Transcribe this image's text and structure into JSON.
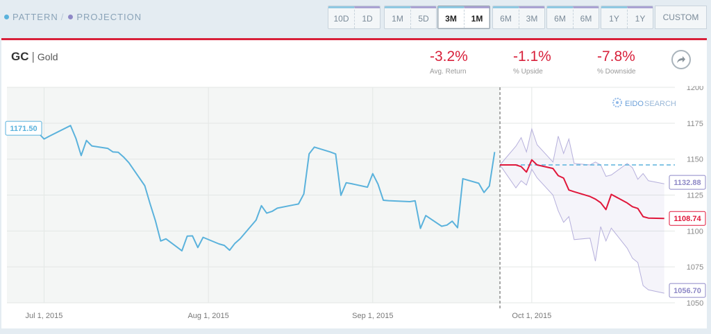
{
  "nav": {
    "pattern": "PATTERN",
    "separator": "/",
    "projection": "PROJECTION",
    "pattern_color": "#5ab2dc",
    "projection_color": "#8e88c6"
  },
  "ranges": [
    {
      "left": "10D",
      "right": "1D",
      "active": false
    },
    {
      "left": "1M",
      "right": "5D",
      "active": false
    },
    {
      "left": "3M",
      "right": "1M",
      "active": true
    },
    {
      "left": "6M",
      "right": "3M",
      "active": false
    },
    {
      "left": "6M",
      "right": "6M",
      "active": false
    },
    {
      "left": "1Y",
      "right": "1Y",
      "active": false
    }
  ],
  "custom_label": "CUSTOM",
  "header": {
    "symbol": "GC",
    "divider": "|",
    "name": "Gold"
  },
  "stats": [
    {
      "value": "-3.2%",
      "label": "Avg. Return"
    },
    {
      "value": "-1.1%",
      "label": "% Upside"
    },
    {
      "value": "-7.8%",
      "label": "% Downside"
    }
  ],
  "share_icon": "share-arrow-icon",
  "watermark": {
    "eido": "EIDO",
    "search": "SEARCH"
  },
  "colors": {
    "accent": "#d8203a",
    "pattern": "#5ab2dc",
    "projection": "#e0163a",
    "band": "#a9a2d2"
  },
  "chart_data": {
    "type": "line",
    "xlabel": "",
    "ylabel": "",
    "ylim": [
      1050,
      1200
    ],
    "y_ticks": [
      "1200",
      "1175",
      "1150",
      "1125",
      "1100",
      "1075",
      "1050"
    ],
    "x_ticks": [
      "Jul 1, 2015",
      "Aug 1, 2015",
      "Sep 1, 2015",
      "Oct 1, 2015"
    ],
    "grid": true,
    "start_label": "1171.50",
    "end_labels": {
      "upper": "1132.88",
      "mid": "1108.74",
      "lower": "1056.70"
    },
    "pattern": {
      "x": [
        "2015-06-25",
        "2015-06-29",
        "2015-06-30",
        "2015-07-01",
        "2015-07-02",
        "2015-07-06",
        "2015-07-07",
        "2015-07-08",
        "2015-07-09",
        "2015-07-10",
        "2015-07-13",
        "2015-07-14",
        "2015-07-15",
        "2015-07-16",
        "2015-07-17",
        "2015-07-20",
        "2015-07-21",
        "2015-07-22",
        "2015-07-23",
        "2015-07-24",
        "2015-07-27",
        "2015-07-28",
        "2015-07-29",
        "2015-07-30",
        "2015-07-31",
        "2015-08-03",
        "2015-08-04",
        "2015-08-05",
        "2015-08-06",
        "2015-08-07",
        "2015-08-10",
        "2015-08-11",
        "2015-08-12",
        "2015-08-13",
        "2015-08-14",
        "2015-08-17",
        "2015-08-18",
        "2015-08-19",
        "2015-08-20",
        "2015-08-21",
        "2015-08-24",
        "2015-08-25",
        "2015-08-26",
        "2015-08-27",
        "2015-08-28",
        "2015-08-31",
        "2015-09-01",
        "2015-09-02",
        "2015-09-03",
        "2015-09-04",
        "2015-09-08",
        "2015-09-09",
        "2015-09-10",
        "2015-09-11",
        "2015-09-14",
        "2015-09-15",
        "2015-09-16",
        "2015-09-17",
        "2015-09-18",
        "2015-09-21",
        "2015-09-22",
        "2015-09-23",
        "2015-09-24"
      ],
      "y": [
        1171.5,
        1171.3,
        1168.0,
        1164.0,
        1166.0,
        1173.4,
        1164.5,
        1152.5,
        1163.0,
        1159.2,
        1157.5,
        1155.0,
        1154.8,
        1151.5,
        1147.5,
        1131.5,
        1119.0,
        1107.2,
        1093.0,
        1094.5,
        1086.2,
        1096.4,
        1096.6,
        1088.5,
        1095.6,
        1091.0,
        1090.0,
        1086.6,
        1091.4,
        1094.6,
        1107.6,
        1117.6,
        1112.4,
        1113.6,
        1115.9,
        1118.1,
        1118.8,
        1125.8,
        1153.7,
        1158.4,
        1155.0,
        1153.6,
        1124.8,
        1133.6,
        1132.9,
        1130.5,
        1139.9,
        1132.6,
        1121.4,
        1121.1,
        1120.4,
        1121.0,
        1101.8,
        1110.7,
        1103.3,
        1104.1,
        1106.8,
        1102.3,
        1136.4,
        1133.2,
        1126.8,
        1131.3,
        1155.0
      ]
    },
    "projection": {
      "x": [
        "2015-09-25",
        "2015-09-28",
        "2015-09-29",
        "2015-09-30",
        "2015-10-01",
        "2015-10-02",
        "2015-10-05",
        "2015-10-06",
        "2015-10-07",
        "2015-10-08",
        "2015-10-09",
        "2015-10-12",
        "2015-10-13",
        "2015-10-14",
        "2015-10-15",
        "2015-10-16",
        "2015-10-19",
        "2015-10-20",
        "2015-10-21",
        "2015-10-22",
        "2015-10-23",
        "2015-10-26"
      ],
      "mid": [
        1146.0,
        1146.0,
        1144.8,
        1141.0,
        1149.5,
        1146.0,
        1143.5,
        1138.5,
        1136.8,
        1128.5,
        1127.3,
        1124.0,
        1122.2,
        1119.7,
        1114.9,
        1125.5,
        1119.5,
        1116.9,
        1115.7,
        1110.0,
        1109.0,
        1108.74
      ],
      "upper": [
        1146.0,
        1159.0,
        1165.0,
        1155.0,
        1171.0,
        1160.0,
        1148.0,
        1166.0,
        1154.0,
        1164.0,
        1147.0,
        1146.0,
        1148.0,
        1146.0,
        1138.0,
        1139.0,
        1147.0,
        1144.0,
        1136.0,
        1140.0,
        1135.0,
        1132.88
      ],
      "lower": [
        1146.0,
        1130.0,
        1135.0,
        1132.0,
        1143.0,
        1137.0,
        1125.0,
        1114.0,
        1106.0,
        1110.0,
        1094.0,
        1095.0,
        1079.0,
        1103.0,
        1093.0,
        1102.0,
        1088.0,
        1081.0,
        1078.0,
        1062.0,
        1059.0,
        1056.7
      ],
      "reference_level": 1146.0
    }
  }
}
